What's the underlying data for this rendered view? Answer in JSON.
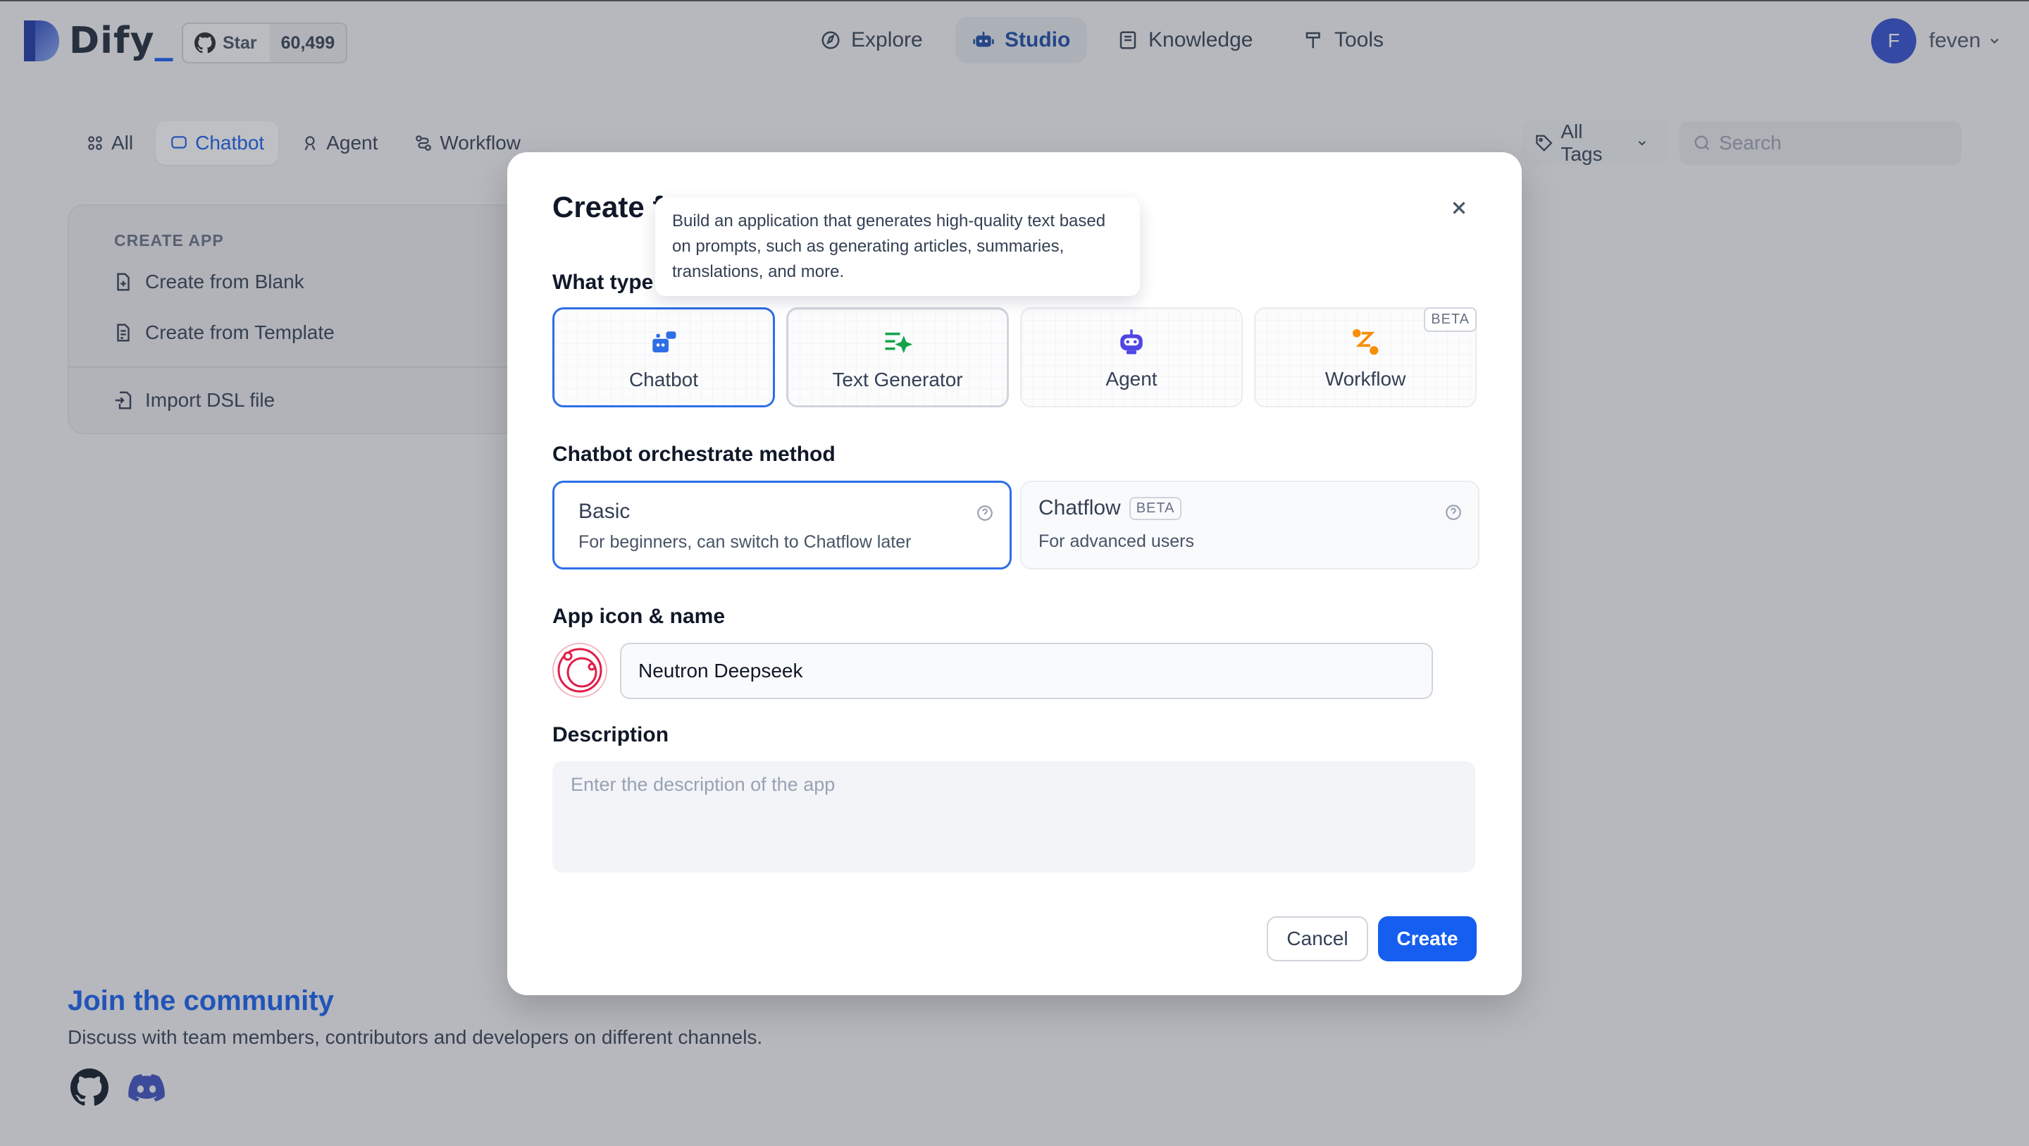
{
  "brand": {
    "name": "Dify",
    "underscore": "_"
  },
  "github": {
    "label": "Star",
    "count": "60,499"
  },
  "nav": [
    {
      "label": "Explore",
      "icon": "compass-icon"
    },
    {
      "label": "Studio",
      "icon": "robot-icon",
      "active": true
    },
    {
      "label": "Knowledge",
      "icon": "book-icon"
    },
    {
      "label": "Tools",
      "icon": "hammer-icon"
    }
  ],
  "user": {
    "initial": "F",
    "name": "feven"
  },
  "filters": {
    "tabs": [
      {
        "label": "All"
      },
      {
        "label": "Chatbot",
        "active": true
      },
      {
        "label": "Agent"
      },
      {
        "label": "Workflow"
      }
    ],
    "tags_label": "All Tags",
    "search_placeholder": "Search"
  },
  "create_app": {
    "header": "CREATE APP",
    "items": [
      "Create from Blank",
      "Create from Template",
      "Import DSL file"
    ]
  },
  "community": {
    "title": "Join the community",
    "subtitle": "Discuss with team members, contributors and developers on different channels."
  },
  "modal": {
    "title_visible": "Create f",
    "type_label_visible": "What type",
    "types": [
      {
        "name": "Chatbot",
        "selected": true
      },
      {
        "name": "Text Generator",
        "hovered": true
      },
      {
        "name": "Agent"
      },
      {
        "name": "Workflow",
        "badge": "BETA"
      }
    ],
    "method_label": "Chatbot orchestrate method",
    "methods": [
      {
        "title": "Basic",
        "desc": "For beginners, can switch to Chatflow later",
        "selected": true
      },
      {
        "title": "Chatflow",
        "badge": "BETA",
        "desc": "For advanced users"
      }
    ],
    "icon_name_label": "App icon & name",
    "app_name": "Neutron Deepseek",
    "description_label": "Description",
    "description_placeholder": "Enter the description of the app",
    "cancel": "Cancel",
    "create": "Create",
    "tooltip": "Build an application that generates high-quality text based on prompts, such as generating articles, summaries, translations, and more."
  },
  "colors": {
    "primary": "#155eef",
    "selected_border": "#2e6fe8",
    "workflow_icon": "#f79009",
    "text_gen_icon": "#16a34a",
    "app_icon": "#e11d48"
  }
}
